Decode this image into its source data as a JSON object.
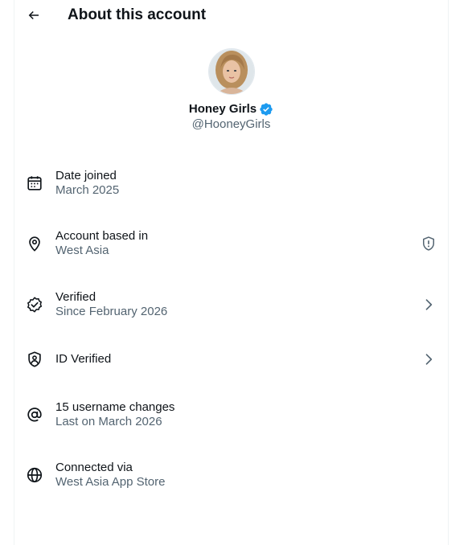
{
  "header": {
    "title": "About this account"
  },
  "profile": {
    "name": "Honey Girls",
    "handle": "@HooneyGirls",
    "verified_color": "#1d9bf0"
  },
  "details": [
    {
      "icon": "calendar-icon",
      "label": "Date joined",
      "value": "March 2025"
    },
    {
      "icon": "location-pin-icon",
      "label": "Account based in",
      "value": "West Asia",
      "trailing": "shield-alert-icon"
    },
    {
      "icon": "verified-badge-icon",
      "label": "Verified",
      "value": "Since February 2026",
      "trailing": "chevron-right-icon"
    },
    {
      "icon": "id-shield-icon",
      "label": "ID Verified",
      "trailing": "chevron-right-icon"
    },
    {
      "icon": "at-sign-icon",
      "label": "15 username changes",
      "value": "Last on March 2026"
    },
    {
      "icon": "globe-icon",
      "label": "Connected via",
      "value": "West Asia App Store"
    }
  ]
}
